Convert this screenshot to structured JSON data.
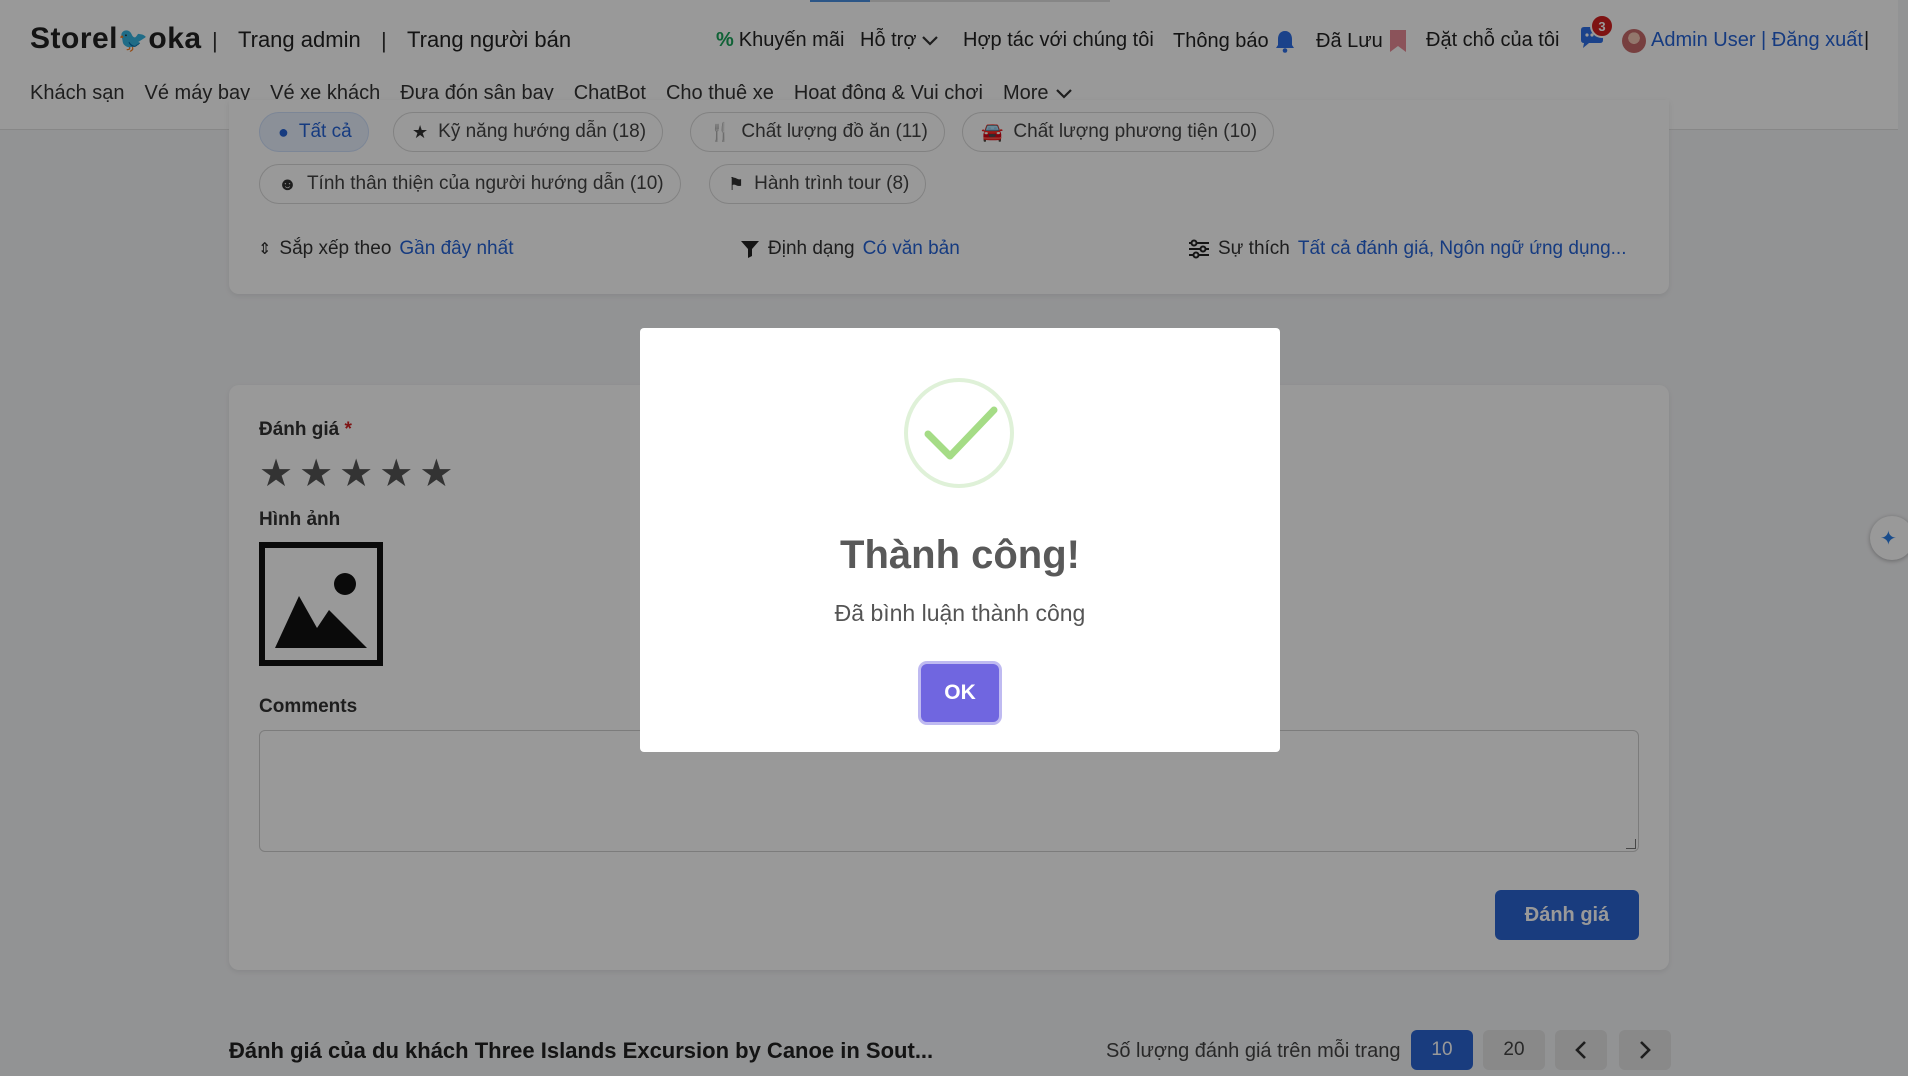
{
  "header": {
    "logo_left": "Storel",
    "logo_right": "oka",
    "separator": "|",
    "admin_link": "Trang admin",
    "seller_link": "Trang người bán",
    "promo": "Khuyến mãi",
    "support": "Hỗ trợ",
    "partner": "Hợp tác với chúng tôi",
    "notifications": "Thông báo",
    "saved": "Đã Lưu",
    "bookings": "Đặt chỗ của tôi",
    "chat_badge": "3",
    "user": "Admin User | Đăng xuất",
    "user_trailing": "|",
    "icons": {
      "promo": "percent-icon",
      "support": "chevron-down-icon",
      "notifications": "bell-icon",
      "saved": "bookmark-icon",
      "chat": "chat-icon"
    },
    "colors": {
      "link_blue": "#2563d6",
      "promo_green": "#1aa35a",
      "badge_red": "#d32020"
    }
  },
  "nav": {
    "items": [
      "Khách sạn",
      "Vé máy bay",
      "Vé xe khách",
      "Đưa đón sân bay",
      "ChatBot",
      "Cho thuê xe",
      "Hoạt động & Vui chơi",
      "More"
    ]
  },
  "filters": {
    "chips": [
      {
        "label": "Tất cả",
        "icon": "check-circle-icon",
        "active": true
      },
      {
        "label": "Kỹ năng hướng dẫn (18)",
        "icon": "star-icon"
      },
      {
        "label": "Chất lượng đồ ăn (11)",
        "icon": "utensils-icon"
      },
      {
        "label": "Chất lượng phương tiện (10)",
        "icon": "car-icon"
      },
      {
        "label": "Tính thân thiện của người hướng dẫn (10)",
        "icon": "smile-icon"
      },
      {
        "label": "Hành trình tour (8)",
        "icon": "signpost-icon"
      }
    ],
    "sort_label": "Sắp xếp theo",
    "sort_value": "Gần đây nhất",
    "format_label": "Định dạng",
    "format_value": "Có văn bản",
    "pref_label": "Sự thích",
    "pref_value": "Tất cả đánh giá, Ngôn ngữ ứng dụng..."
  },
  "review_form": {
    "rating_label": "Đánh giá",
    "required_mark": "*",
    "rating": 0,
    "max_rating": 5,
    "images_label": "Hình ảnh",
    "comments_label": "Comments",
    "comment_value": "",
    "submit_label": "Đánh giá"
  },
  "bottom": {
    "title": "Đánh giá của du khách Three Islands Excursion by Canoe in Sout...",
    "per_page_label": "Số lượng đánh giá trên mỗi trang",
    "per_page_options": [
      "10",
      "20"
    ],
    "per_page_selected": "10",
    "prev_icon": "chevron-left-icon",
    "next_icon": "chevron-right-icon"
  },
  "modal": {
    "icon": "success-check-icon",
    "title": "Thành công!",
    "message": "Đã bình luận thành công",
    "ok_label": "OK",
    "colors": {
      "ok_button": "#7066e0",
      "check": "#a5dc86"
    }
  }
}
